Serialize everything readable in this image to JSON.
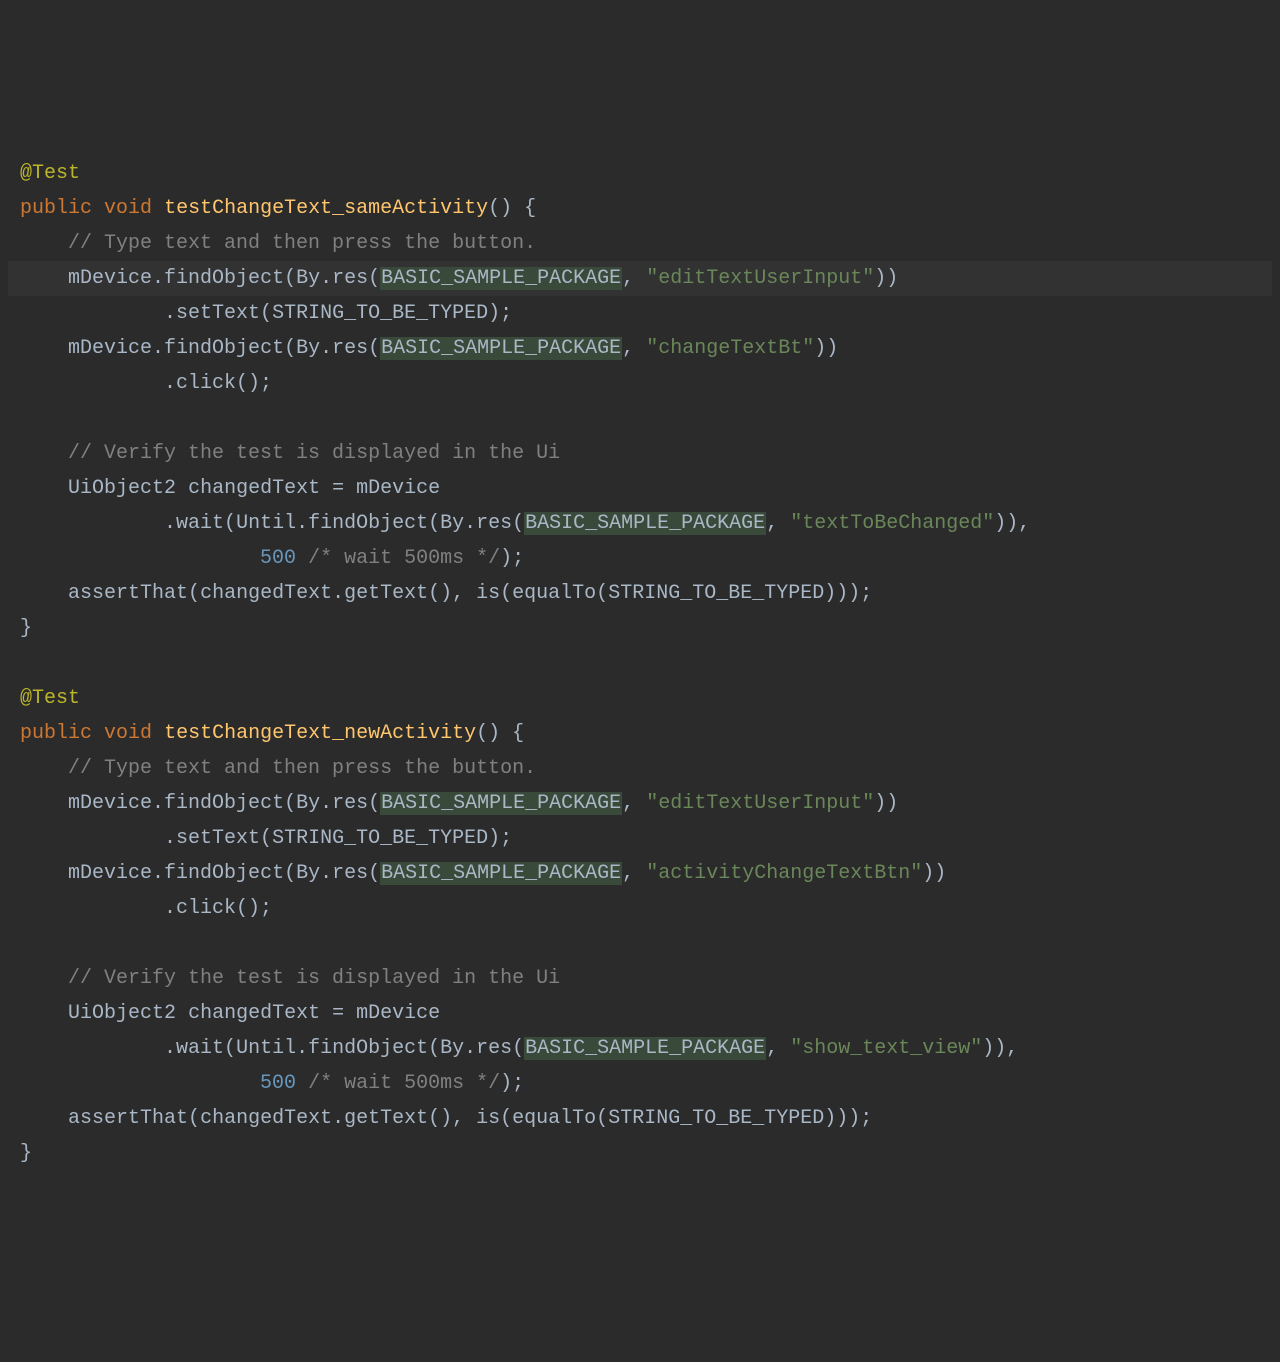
{
  "colors": {
    "background": "#2b2b2b",
    "highlightLine": "#323232",
    "text": "#a9b7c6",
    "keyword": "#cc7832",
    "annotation": "#bbb529",
    "funcname": "#ffc66d",
    "string": "#6a8759",
    "number": "#6897bb",
    "comment": "#808080",
    "constHighlightBg": "#3a4a3a"
  },
  "code": {
    "method1": {
      "annotation": "@Test",
      "modifiers": [
        "public",
        "void"
      ],
      "name": "testChangeText_sameActivity",
      "body": {
        "comment1": "// Type text and then press the button.",
        "stmt1a": {
          "receiver": "mDevice",
          "call1": "findObject",
          "arg_call": "By.res",
          "const": "BASIC_SAMPLE_PACKAGE",
          "str": "\"editTextUserInput\"",
          "chain": ".setText",
          "chain_arg": "STRING_TO_BE_TYPED"
        },
        "stmt1b": {
          "receiver": "mDevice",
          "call1": "findObject",
          "arg_call": "By.res",
          "const": "BASIC_SAMPLE_PACKAGE",
          "str": "\"changeTextBt\"",
          "chain": ".click"
        },
        "comment2": "// Verify the test is displayed in the Ui",
        "stmt2": {
          "type": "UiObject2",
          "var": "changedText",
          "rhs": "mDevice",
          "chain": ".wait",
          "inner_call": "Until.findObject",
          "inner_arg_call": "By.res",
          "const": "BASIC_SAMPLE_PACKAGE",
          "str": "\"textToBeChanged\"",
          "timeout": "500",
          "timeout_comment": "/* wait 500ms */"
        },
        "stmt3": {
          "call": "assertThat",
          "arg1": "changedText.getText()",
          "matcher": "is",
          "matcher_inner": "equalTo",
          "matcher_arg": "STRING_TO_BE_TYPED"
        }
      }
    },
    "method2": {
      "annotation": "@Test",
      "modifiers": [
        "public",
        "void"
      ],
      "name": "testChangeText_newActivity",
      "body": {
        "comment1": "// Type text and then press the button.",
        "stmt1a": {
          "receiver": "mDevice",
          "call1": "findObject",
          "arg_call": "By.res",
          "const": "BASIC_SAMPLE_PACKAGE",
          "str": "\"editTextUserInput\"",
          "chain": ".setText",
          "chain_arg": "STRING_TO_BE_TYPED"
        },
        "stmt1b": {
          "receiver": "mDevice",
          "call1": "findObject",
          "arg_call": "By.res",
          "const": "BASIC_SAMPLE_PACKAGE",
          "str": "\"activityChangeTextBtn\"",
          "chain": ".click"
        },
        "comment2": "// Verify the test is displayed in the Ui",
        "stmt2": {
          "type": "UiObject2",
          "var": "changedText",
          "rhs": "mDevice",
          "chain": ".wait",
          "inner_call": "Until.findObject",
          "inner_arg_call": "By.res",
          "const": "BASIC_SAMPLE_PACKAGE",
          "str": "\"show_text_view\"",
          "timeout": "500",
          "timeout_comment": "/* wait 500ms */"
        },
        "stmt3": {
          "call": "assertThat",
          "arg1": "changedText.getText()",
          "matcher": "is",
          "matcher_inner": "equalTo",
          "matcher_arg": "STRING_TO_BE_TYPED"
        }
      }
    }
  }
}
